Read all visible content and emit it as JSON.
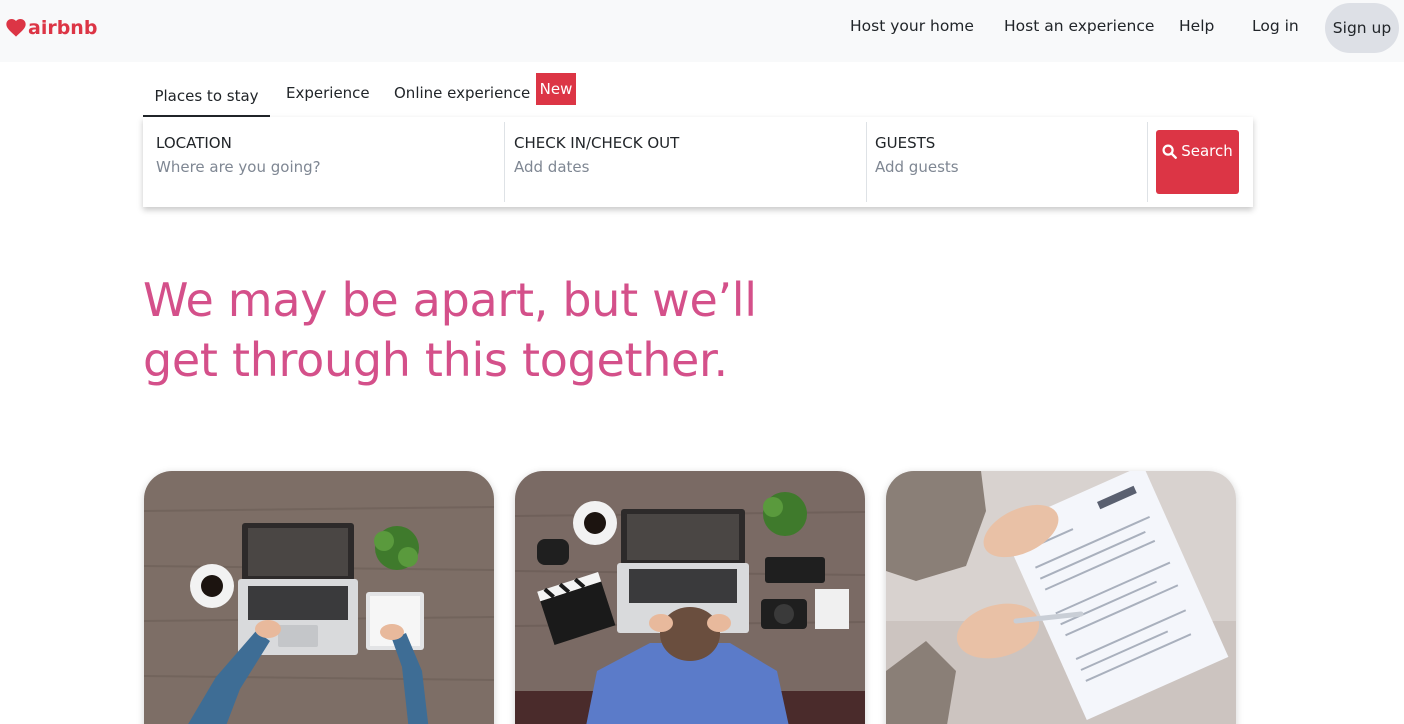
{
  "brand": {
    "name": "airbnb",
    "color": "#dc3545",
    "icon": "heart-icon"
  },
  "nav": {
    "host_home": "Host your home",
    "host_experience": "Host an experience",
    "help": "Help",
    "login": "Log in",
    "signup": "Sign up"
  },
  "tabs": [
    {
      "label": "Places to stay",
      "active": true
    },
    {
      "label": "Experience",
      "active": false
    },
    {
      "label": "Online experience",
      "active": false
    }
  ],
  "badge": "New",
  "search": {
    "location_label": "LOCATION",
    "location_placeholder": "Where are you going?",
    "dates_label": "CHECK IN/CHECK OUT",
    "dates_placeholder": "Add dates",
    "guests_label": "GUESTS",
    "guests_placeholder": "Add guests",
    "button_label": "Search",
    "button_icon": "search-icon"
  },
  "hero": {
    "line1": "We may be apart, but we’ll",
    "line2": "get through this together.",
    "color": "#d4508a"
  },
  "cards": [
    {
      "image": "laptop-desk-photo"
    },
    {
      "image": "stressed-person-laptop-photo"
    },
    {
      "image": "resume-document-photo"
    }
  ]
}
